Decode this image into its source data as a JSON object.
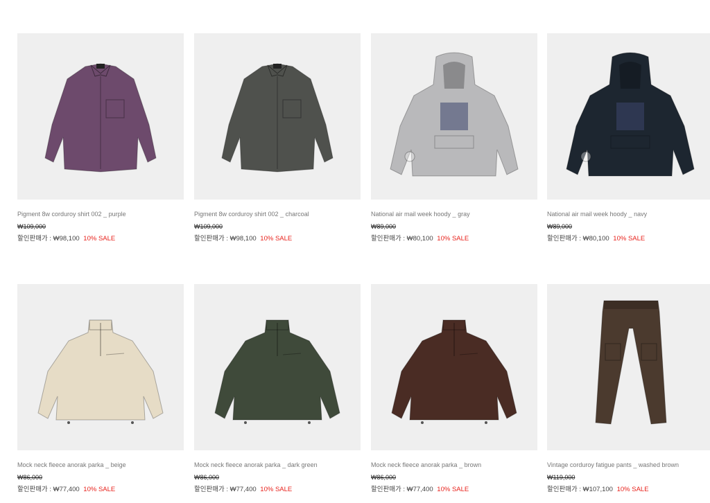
{
  "products": [
    {
      "name": "Pigment 8w corduroy shirt 002 _ purple",
      "original_price": "₩109,000",
      "sale_label": "할인판매가 :",
      "sale_price": "₩98,100",
      "discount": "10% SALE",
      "color": "#6d4a6c",
      "kind": "shirt"
    },
    {
      "name": "Pigment 8w corduroy shirt 002 _ charcoal",
      "original_price": "₩109,000",
      "sale_label": "할인판매가 :",
      "sale_price": "₩98,100",
      "discount": "10% SALE",
      "color": "#4f514d",
      "kind": "shirt"
    },
    {
      "name": "National air mail week hoody _ gray",
      "original_price": "₩89,000",
      "sale_label": "할인판매가 :",
      "sale_price": "₩80,100",
      "discount": "10% SALE",
      "color": "#b9b9bb",
      "kind": "hoody"
    },
    {
      "name": "National air mail week hoody _ navy",
      "original_price": "₩89,000",
      "sale_label": "할인판매가 :",
      "sale_price": "₩80,100",
      "discount": "10% SALE",
      "color": "#1d2630",
      "kind": "hoody"
    },
    {
      "name": "Mock neck fleece anorak parka _ beige",
      "original_price": "₩86,000",
      "sale_label": "할인판매가 :",
      "sale_price": "₩77,400",
      "discount": "10% SALE",
      "color": "#e6dcc6",
      "kind": "anorak"
    },
    {
      "name": "Mock neck fleece anorak parka _ dark green",
      "original_price": "₩86,000",
      "sale_label": "할인판매가 :",
      "sale_price": "₩77,400",
      "discount": "10% SALE",
      "color": "#3f4a3a",
      "kind": "anorak"
    },
    {
      "name": "Mock neck fleece anorak parka _ brown",
      "original_price": "₩86,000",
      "sale_label": "할인판매가 :",
      "sale_price": "₩77,400",
      "discount": "10% SALE",
      "color": "#4a2c24",
      "kind": "anorak"
    },
    {
      "name": "Vintage corduroy fatigue pants _ washed brown",
      "original_price": "₩119,000",
      "sale_label": "할인판매가 :",
      "sale_price": "₩107,100",
      "discount": "10% SALE",
      "color": "#4b3a2e",
      "kind": "pants"
    }
  ],
  "colors": {
    "sale_red": "#e8221c",
    "thumb_bg": "#efefef"
  }
}
